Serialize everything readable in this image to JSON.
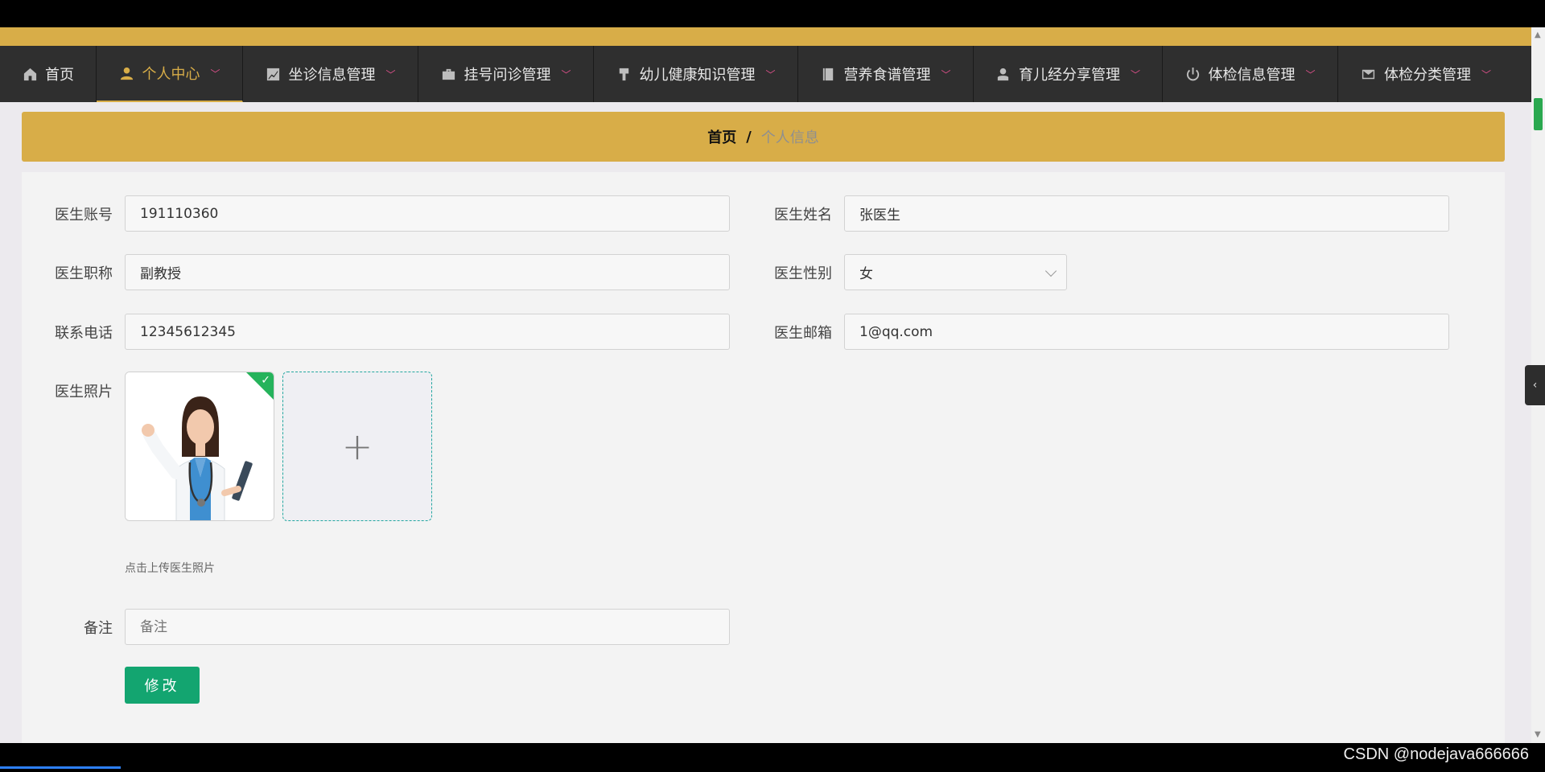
{
  "nav": {
    "items": [
      {
        "label": "首页",
        "icon": "home-icon"
      },
      {
        "label": "个人中心",
        "icon": "user-icon",
        "active": true
      },
      {
        "label": "坐诊信息管理",
        "icon": "chart-icon"
      },
      {
        "label": "挂号问诊管理",
        "icon": "briefcase-icon"
      },
      {
        "label": "幼儿健康知识管理",
        "icon": "brush-icon"
      },
      {
        "label": "营养食谱管理",
        "icon": "book-icon"
      },
      {
        "label": "育儿经分享管理",
        "icon": "person-icon"
      },
      {
        "label": "体检信息管理",
        "icon": "power-icon"
      },
      {
        "label": "体检分类管理",
        "icon": "mail-icon"
      }
    ],
    "accent_color": "#d8ad48",
    "caret_color": "#e0508c"
  },
  "breadcrumb": {
    "home": "首页",
    "separator": "/",
    "current": "个人信息"
  },
  "form": {
    "account_label": "医生账号",
    "account_value": "191110360",
    "name_label": "医生姓名",
    "name_value": "张医生",
    "title_label": "医生职称",
    "title_value": "副教授",
    "gender_label": "医生性别",
    "gender_value": "女",
    "phone_label": "联系电话",
    "phone_value": "12345612345",
    "email_label": "医生邮箱",
    "email_value": "1@qq.com",
    "photo_label": "医生照片",
    "photo_hint": "点击上传医生照片",
    "remark_label": "备注",
    "remark_placeholder": "备注",
    "remark_value": "",
    "submit_label": "修改",
    "submit_color": "#13a570"
  },
  "watermark": "CSDN @nodejava666666"
}
